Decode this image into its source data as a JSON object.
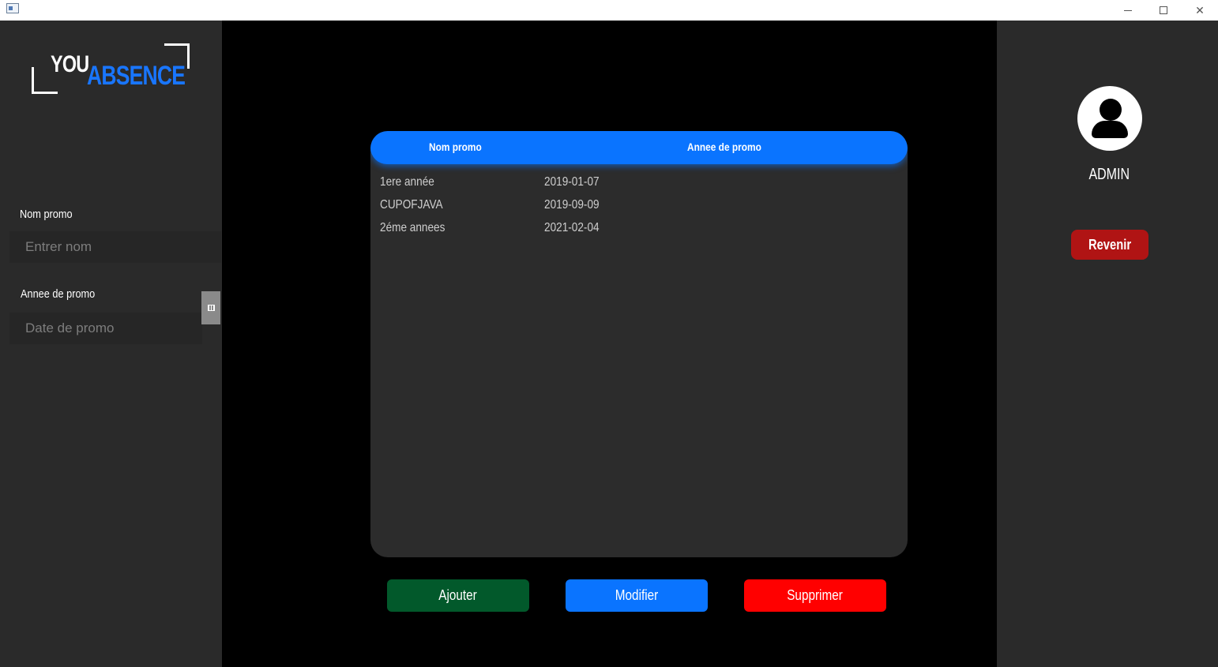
{
  "window": {
    "minimize_icon": "minimize-icon",
    "maximize_icon": "maximize-icon",
    "close_icon": "close-icon"
  },
  "logo": {
    "part1": "YOU",
    "part2": "ABSENCE"
  },
  "form": {
    "name_label": "Nom promo",
    "name_placeholder": "Entrer nom",
    "year_label": "Annee de promo",
    "year_placeholder": "Date de promo",
    "calendar_icon": "calendar-icon"
  },
  "table": {
    "columns": [
      "Nom promo",
      "Annee de promo"
    ],
    "rows": [
      [
        "1ere année",
        "2019-01-07"
      ],
      [
        "CUPOFJAVA",
        "2019-09-09"
      ],
      [
        "2éme annees",
        "2021-02-04"
      ]
    ]
  },
  "actions": {
    "add": "Ajouter",
    "edit": "Modifier",
    "delete": "Supprimer"
  },
  "colors": {
    "add": "#02592b",
    "edit": "#0a74ff",
    "delete": "#ff0000",
    "back": "#b01414",
    "accent": "#1976ff"
  },
  "user": {
    "name": "ADMIN",
    "avatar_icon": "user-icon"
  },
  "back_button": "Revenir"
}
